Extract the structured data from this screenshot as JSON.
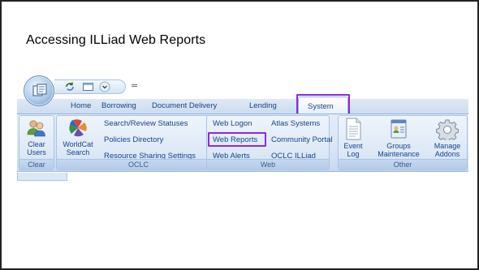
{
  "slide": {
    "title": "Accessing ILLiad Web Reports"
  },
  "tabs": {
    "home": "Home",
    "borrowing": "Borrowing",
    "document_delivery": "Document Delivery",
    "lending": "Lending",
    "system": "System"
  },
  "groups": {
    "clear": {
      "label": "Clear",
      "button_line1": "Clear",
      "button_line2": "Users",
      "icon": "users-icon"
    },
    "oclc": {
      "label": "OCLC",
      "worldcat_line1": "WorldCat",
      "worldcat_line2": "Search",
      "worldcat_icon": "worldcat-icon",
      "items": [
        "Search/Review Statuses",
        "Policies Directory",
        "Resource Sharing Settings"
      ]
    },
    "web": {
      "label": "Web",
      "items_left": [
        "Web Logon",
        "Web Reports",
        "Web Alerts"
      ],
      "items_right": [
        "Atlas Systems",
        "Community Portal",
        "OCLC ILLiad"
      ]
    },
    "other": {
      "label": "Other",
      "event_log_line1": "Event",
      "event_log_line2": "Log",
      "groups_line1": "Groups",
      "groups_line2": "Maintenance",
      "addons_line1": "Manage",
      "addons_line2": "Addons"
    }
  },
  "colors": {
    "highlight": "#8a2be2",
    "ribbon_text": "#15428b",
    "ribbon_bg": "#dde8f6"
  }
}
